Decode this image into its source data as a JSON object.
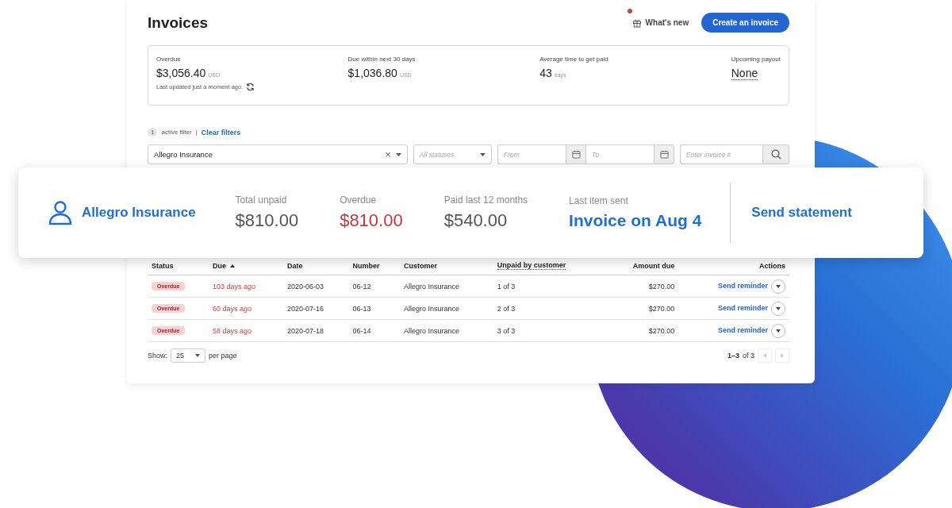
{
  "header": {
    "title": "Invoices",
    "whats_new": {
      "label": "What's new",
      "unread": true
    },
    "create_button": "Create an invoice"
  },
  "summary": [
    {
      "kind": "amount",
      "label": "Overdue",
      "value": "$3,056.40",
      "unit": "USD",
      "note": "Last updated just a moment ago."
    },
    {
      "kind": "amount",
      "label": "Due within next 30 days",
      "value": "$1,036.80",
      "unit": "USD"
    },
    {
      "kind": "amount",
      "label": "Average time to get paid",
      "value": "43",
      "unit": "days"
    },
    {
      "kind": "link",
      "label": "Upcoming payout",
      "value": "None"
    }
  ],
  "filters": {
    "count": "1",
    "count_label": "active filter",
    "separator": "|",
    "clear": "Clear filters",
    "customer": "Allegro Insurance",
    "clear_icon": "×",
    "status_placeholder": "All statuses",
    "from_placeholder": "From",
    "to_placeholder": "To",
    "invoice_placeholder": "Enter invoice #"
  },
  "customer_card": {
    "name": "Allegro Insurance",
    "stats": [
      {
        "kind": "plain",
        "label": "Total unpaid",
        "value": "$810.00"
      },
      {
        "kind": "alert",
        "label": "Overdue",
        "value": "$810.00"
      },
      {
        "kind": "plain",
        "label": "Paid last 12 months",
        "value": "$540.00"
      },
      {
        "kind": "link",
        "label": "Last item sent",
        "value": "Invoice on Aug 4"
      }
    ],
    "action": "Send statement"
  },
  "table": {
    "columns": [
      {
        "label": "Status",
        "sorted": false,
        "dotted": false
      },
      {
        "label": "Due",
        "sorted": true,
        "dotted": false
      },
      {
        "label": "Date",
        "sorted": false,
        "dotted": false
      },
      {
        "label": "Number",
        "sorted": false,
        "dotted": false
      },
      {
        "label": "Customer",
        "sorted": false,
        "dotted": false
      },
      {
        "label": "Unpaid by customer",
        "sorted": false,
        "dotted": true
      },
      {
        "label": "Amount due",
        "sorted": false,
        "dotted": false
      },
      {
        "label": "Actions",
        "sorted": false,
        "dotted": false
      }
    ],
    "rows": [
      {
        "status": "Overdue",
        "overdue": true,
        "due": "103 days ago",
        "date": "2020-06-03",
        "number": "06-12",
        "customer": "Allegro Insurance",
        "unpaid": "1 of 3",
        "amount": "$270.00",
        "action": "Send reminder"
      },
      {
        "status": "Overdue",
        "overdue": true,
        "due": "60 days ago",
        "date": "2020-07-16",
        "number": "06-13",
        "customer": "Allegro Insurance",
        "unpaid": "2 of 3",
        "amount": "$270.00",
        "action": "Send reminder"
      },
      {
        "status": "Overdue",
        "overdue": true,
        "due": "58 days ago",
        "date": "2020-07-18",
        "number": "06-14",
        "customer": "Allegro Insurance",
        "unpaid": "3 of 3",
        "amount": "$270.00",
        "action": "Send reminder"
      }
    ]
  },
  "footer": {
    "show_label": "Show:",
    "page_size": "25",
    "per_page": "per page",
    "range": "1–3",
    "of": "of 3"
  }
}
